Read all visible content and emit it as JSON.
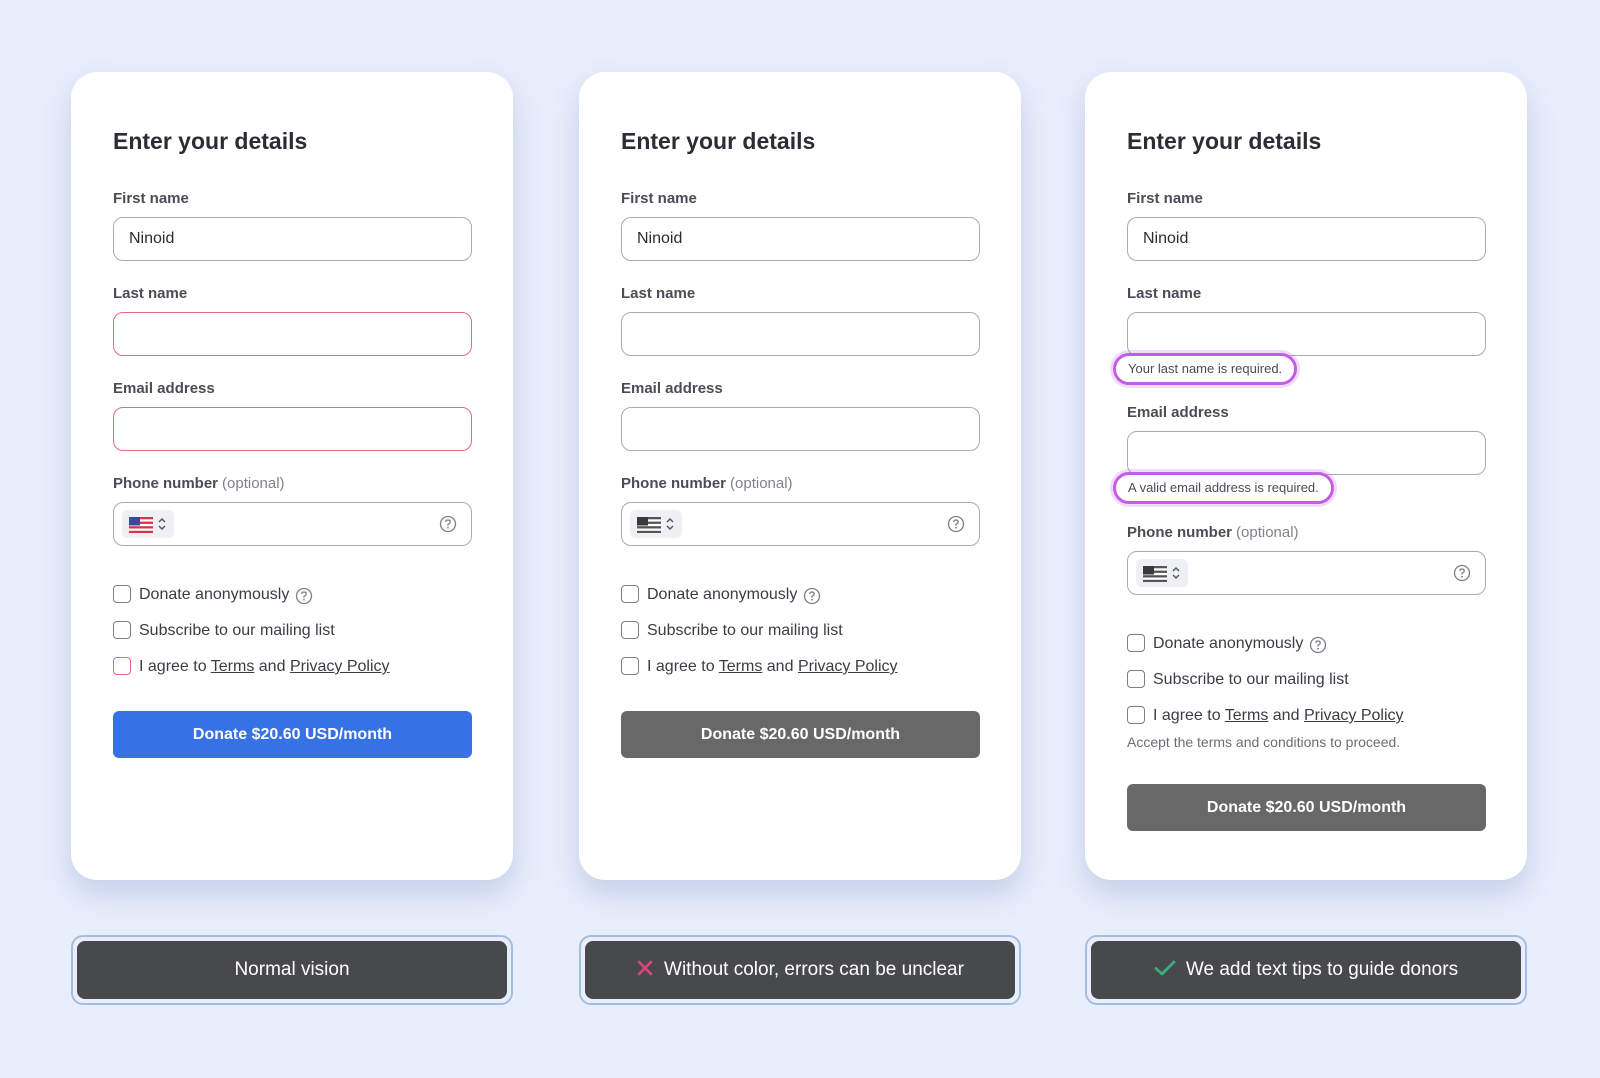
{
  "colors": {
    "page_bg": "#e8eefc",
    "error_red": "#e46a82",
    "primary_blue": "#3672e4",
    "neutral_gray": "#686868",
    "tip_purple": "#c35de8",
    "caption_bg": "#48494d",
    "cross_pink": "#e6417a",
    "check_green": "#36b07c"
  },
  "cards": [
    {
      "title": "Enter your details",
      "first_name_label": "First name",
      "first_name_value": "Ninoid",
      "last_name_label": "Last name",
      "last_name_value": "",
      "email_label": "Email address",
      "email_value": "",
      "phone_label": "Phone number",
      "phone_optional": "(optional)",
      "phone_value": "",
      "flag_icon": "us-flag-icon",
      "anon_label": "Donate anonymously",
      "subscribe_label": "Subscribe to our mailing list",
      "agree_prefix": "I agree to",
      "terms_link": "Terms",
      "agree_and": "and",
      "privacy_link": "Privacy Policy",
      "donate_button": "Donate $20.60 USD/month"
    },
    {
      "title": "Enter your details",
      "first_name_label": "First name",
      "first_name_value": "Ninoid",
      "last_name_label": "Last name",
      "last_name_value": "",
      "email_label": "Email address",
      "email_value": "",
      "phone_label": "Phone number",
      "phone_optional": "(optional)",
      "phone_value": "",
      "flag_icon": "us-flag-grayscale-icon",
      "anon_label": "Donate anonymously",
      "subscribe_label": "Subscribe to our mailing list",
      "agree_prefix": "I agree to",
      "terms_link": "Terms",
      "agree_and": "and",
      "privacy_link": "Privacy Policy",
      "donate_button": "Donate $20.60 USD/month"
    },
    {
      "title": "Enter your details",
      "first_name_label": "First name",
      "first_name_value": "Ninoid",
      "last_name_label": "Last name",
      "last_name_value": "",
      "last_name_error": "Your last name is required.",
      "email_label": "Email address",
      "email_value": "",
      "email_error": "A valid email address is required.",
      "phone_label": "Phone number",
      "phone_optional": "(optional)",
      "phone_value": "",
      "flag_icon": "us-flag-grayscale-icon",
      "anon_label": "Donate anonymously",
      "subscribe_label": "Subscribe to our mailing list",
      "agree_prefix": "I agree to",
      "terms_link": "Terms",
      "agree_and": "and",
      "privacy_link": "Privacy Policy",
      "terms_hint": "Accept the terms and conditions to proceed.",
      "donate_button": "Donate $20.60 USD/month"
    }
  ],
  "captions": [
    {
      "text": "Normal vision",
      "icon": ""
    },
    {
      "text": "Without color, errors can be unclear",
      "icon": "cross-icon"
    },
    {
      "text": "We add text tips to guide donors",
      "icon": "check-icon"
    }
  ]
}
